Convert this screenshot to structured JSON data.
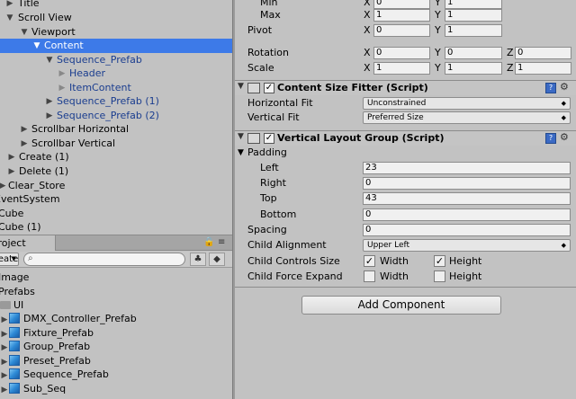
{
  "hierarchy": {
    "items": [
      {
        "label": "Title",
        "arrow": "▶",
        "prefab": false,
        "selected": false
      },
      {
        "label": "Scroll View",
        "arrow": "▼",
        "prefab": false,
        "selected": false
      },
      {
        "label": "Viewport",
        "arrow": "▼",
        "prefab": false,
        "selected": false
      },
      {
        "label": "Content",
        "arrow": "▼",
        "prefab": false,
        "selected": true
      },
      {
        "label": "Sequence_Prefab",
        "arrow": "▼",
        "prefab": true,
        "selected": false
      },
      {
        "label": "Header",
        "arrow": "▶",
        "prefab": true,
        "selected": false
      },
      {
        "label": "ItemContent",
        "arrow": "▶",
        "prefab": true,
        "selected": false
      },
      {
        "label": "Sequence_Prefab (1)",
        "arrow": "▶",
        "prefab": true,
        "selected": false
      },
      {
        "label": "Sequence_Prefab (2)",
        "arrow": "▶",
        "prefab": true,
        "selected": false
      },
      {
        "label": "Scrollbar Horizontal",
        "arrow": "▶",
        "prefab": false,
        "selected": false
      },
      {
        "label": "Scrollbar Vertical",
        "arrow": "▶",
        "prefab": false,
        "selected": false
      },
      {
        "label": "Create (1)",
        "arrow": "▶",
        "prefab": false,
        "selected": false
      },
      {
        "label": "Delete (1)",
        "arrow": "▶",
        "prefab": false,
        "selected": false
      },
      {
        "label": "Clear_Store",
        "arrow": "▶",
        "prefab": false,
        "selected": false
      },
      {
        "label": "EventSystem",
        "arrow": "",
        "prefab": false,
        "selected": false
      },
      {
        "label": "Cube",
        "arrow": "",
        "prefab": false,
        "selected": false
      },
      {
        "label": "Cube (1)",
        "arrow": "",
        "prefab": false,
        "selected": false
      }
    ]
  },
  "project": {
    "tab_label": "Project",
    "create_label": "Create",
    "search_value": "",
    "items": [
      {
        "label": "Image",
        "icon": "none"
      },
      {
        "label": "Prefabs",
        "icon": "none"
      },
      {
        "label": "UI",
        "icon": "folder-icon"
      },
      {
        "label": "DMX_Controller_Prefab",
        "icon": "prefab-cube-icon"
      },
      {
        "label": "Fixture_Prefab",
        "icon": "prefab-cube-icon"
      },
      {
        "label": "Group_Prefab",
        "icon": "prefab-cube-icon"
      },
      {
        "label": "Preset_Prefab",
        "icon": "prefab-cube-icon"
      },
      {
        "label": "Sequence_Prefab",
        "icon": "prefab-cube-icon"
      },
      {
        "label": "Sub_Seq",
        "icon": "prefab-cube-icon"
      }
    ]
  },
  "inspector": {
    "rect_transform": {
      "min": {
        "label": "Min",
        "x_label": "X",
        "x": "0",
        "y_label": "Y",
        "y": "1"
      },
      "max": {
        "label": "Max",
        "x_label": "X",
        "x": "1",
        "y_label": "Y",
        "y": "1"
      },
      "pivot": {
        "label": "Pivot",
        "x_label": "X",
        "x": "0",
        "y_label": "Y",
        "y": "1"
      },
      "rotation": {
        "label": "Rotation",
        "x_label": "X",
        "x": "0",
        "y_label": "Y",
        "y": "0",
        "z_label": "Z",
        "z": "0"
      },
      "scale": {
        "label": "Scale",
        "x_label": "X",
        "x": "1",
        "y_label": "Y",
        "y": "1",
        "z_label": "Z",
        "z": "1"
      }
    },
    "content_size_fitter": {
      "title": "Content Size Fitter (Script)",
      "enabled_mark": "✓",
      "horizontal_fit_label": "Horizontal Fit",
      "horizontal_fit_value": "Unconstrained",
      "vertical_fit_label": "Vertical Fit",
      "vertical_fit_value": "Preferred Size"
    },
    "vertical_layout_group": {
      "title": "Vertical Layout Group (Script)",
      "enabled_mark": "✓",
      "padding_label": "Padding",
      "left_label": "Left",
      "left": "23",
      "right_label": "Right",
      "right": "0",
      "top_label": "Top",
      "top": "43",
      "bottom_label": "Bottom",
      "bottom": "0",
      "spacing_label": "Spacing",
      "spacing": "0",
      "child_alignment_label": "Child Alignment",
      "child_alignment_value": "Upper Left",
      "child_controls_size_label": "Child Controls Size",
      "controls_width_label": "Width",
      "controls_width_checked": "✓",
      "controls_height_label": "Height",
      "controls_height_checked": "✓",
      "child_force_expand_label": "Child Force Expand",
      "force_width_label": "Width",
      "force_width_checked": "",
      "force_height_label": "Height",
      "force_height_checked": ""
    },
    "add_component_label": "Add Component"
  },
  "colors": {
    "selection": "#3d7ae8",
    "prefab_text": "#1a3d8f",
    "panel_bg": "#c2c2c2"
  }
}
